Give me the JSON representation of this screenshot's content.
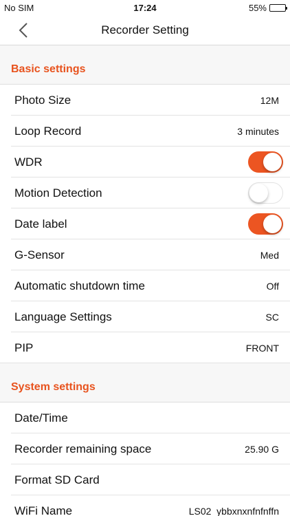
{
  "status_bar": {
    "carrier": "No SIM",
    "time": "17:24",
    "battery_percent": "55%",
    "battery_level": 0.55
  },
  "nav": {
    "title": "Recorder Setting",
    "back_icon": "chevron-left-icon"
  },
  "colors": {
    "accent": "#e8531e",
    "toggle_on": "#ec5522"
  },
  "basic_settings": {
    "header": "Basic settings",
    "photo_size": {
      "label": "Photo Size",
      "value": "12M"
    },
    "loop_record": {
      "label": "Loop Record",
      "value": "3 minutes"
    },
    "wdr": {
      "label": "WDR",
      "on": true
    },
    "motion_detection": {
      "label": "Motion Detection",
      "on": false
    },
    "date_label": {
      "label": "Date label",
      "on": true
    },
    "g_sensor": {
      "label": "G-Sensor",
      "value": "Med"
    },
    "auto_shutdown": {
      "label": "Automatic shutdown time",
      "value": "Off"
    },
    "language": {
      "label": "Language Settings",
      "value": "SC"
    },
    "pip": {
      "label": "PIP",
      "value": "FRONT"
    }
  },
  "system_settings": {
    "header": "System settings",
    "date_time": {
      "label": "Date/Time"
    },
    "remaining_space": {
      "label": "Recorder remaining space",
      "value": "25.90 G"
    },
    "format_sd": {
      "label": "Format SD Card"
    },
    "wifi_name": {
      "label": "WiFi Name",
      "value": "LS02_ybbxnxnfnfnffn"
    }
  }
}
